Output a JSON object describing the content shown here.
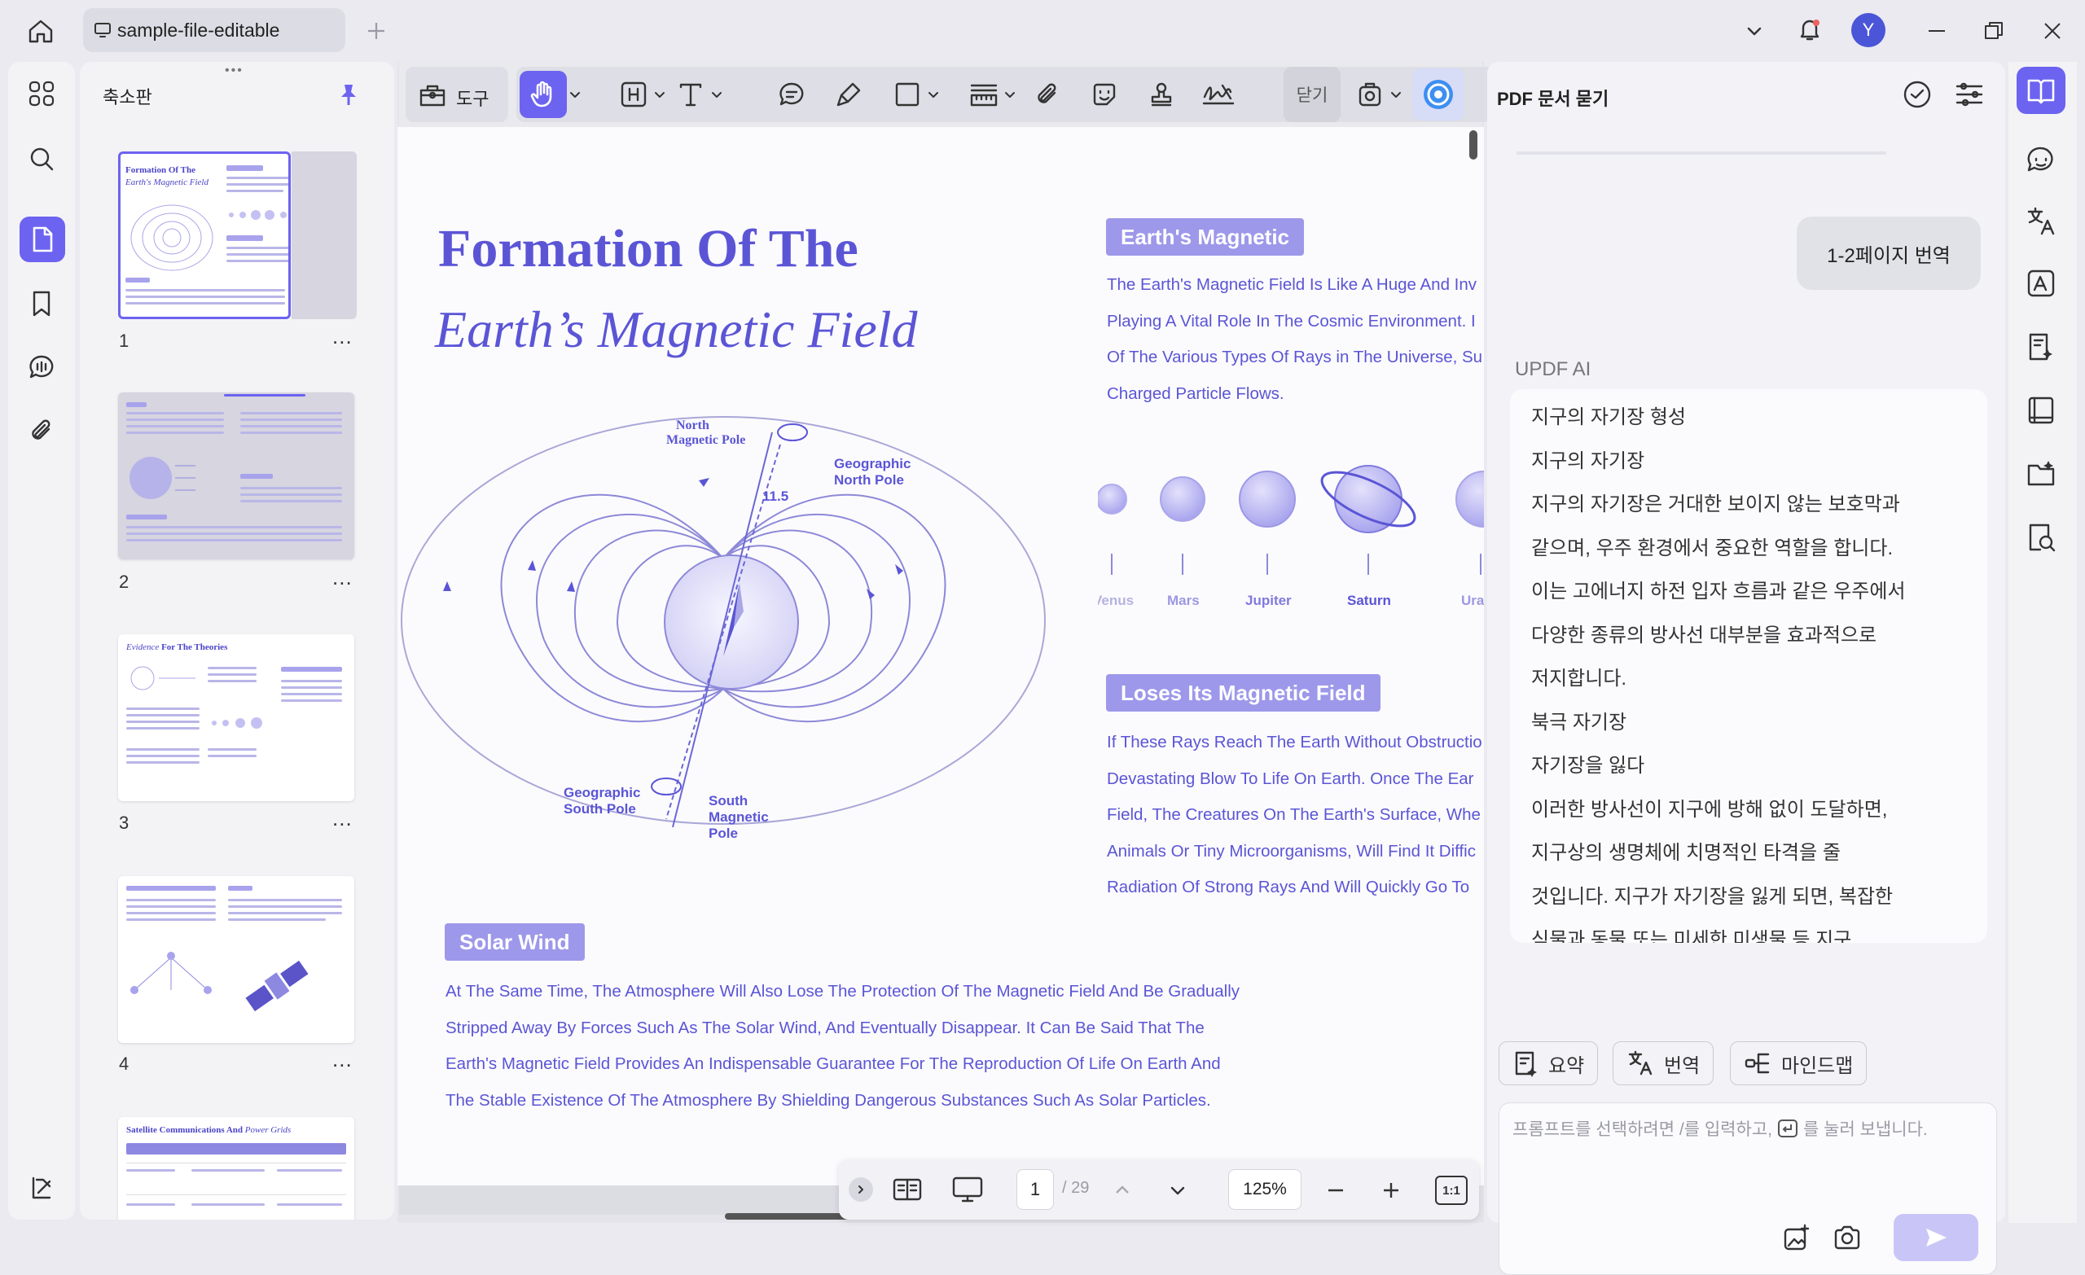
{
  "titlebar": {
    "tab_title": "sample-file-editable",
    "avatar_letter": "Y"
  },
  "thumbnails": {
    "title": "축소판",
    "pages": [
      {
        "number": "1",
        "menu": "..."
      },
      {
        "number": "2",
        "menu": "..."
      },
      {
        "number": "3",
        "menu": "..."
      },
      {
        "number": "4",
        "menu": "..."
      }
    ],
    "thumb1_title_a": "Formation Of The",
    "thumb1_title_b": "Earth's Magnetic Field",
    "thumb3_title_a": "Evidence",
    "thumb3_title_b": "For The Theories",
    "thumb5_title_a": "Satellite Communications And",
    "thumb5_title_b": "Power Grids"
  },
  "toolbar": {
    "tools_label": "도구",
    "close_label": "닫기"
  },
  "document": {
    "title_line1": "Formation Of The",
    "title_line2": "Earth’s Magnetic Field",
    "diagram": {
      "north_magnetic_pole_1": "North",
      "north_magnetic_pole_2": "Magnetic Pole",
      "geographic_north_1": "Geographic",
      "geographic_north_2": "North Pole",
      "angle": "11.5",
      "geographic_south_1": "Geographic",
      "geographic_south_2": "South Pole",
      "south_magnetic_1": "South",
      "south_magnetic_2": "Magnetic",
      "south_magnetic_3": "Pole"
    },
    "section1_heading": "Earth's Magnetic",
    "section1_lines": [
      "The Earth's Magnetic Field Is Like A Huge And Inv",
      "Playing A Vital Role In The Cosmic Environment. I",
      "Of The Various Types Of Rays in The Universe, Su",
      "Charged Particle Flows."
    ],
    "planets": [
      "Venus",
      "Mars",
      "Jupiter",
      "Saturn",
      "Ura"
    ],
    "section2_heading": "Loses Its Magnetic Field",
    "section2_lines": [
      "If These Rays Reach The Earth Without Obstructio",
      "Devastating Blow To Life On Earth. Once The Ear",
      "Field, The Creatures On The Earth's Surface, Whe",
      "Animals Or Tiny Microorganisms, Will Find It Diffic",
      "Radiation Of Strong Rays And Will Quickly Go To"
    ],
    "section3_heading": "Solar Wind",
    "section3_lines": [
      "At The Same Time, The Atmosphere Will Also Lose The Protection Of The Magnetic Field And Be Gradually",
      "Stripped Away By Forces Such As The Solar Wind, And Eventually Disappear. It Can Be Said That The",
      "Earth's Magnetic Field Provides An Indispensable Guarantee For The Reproduction Of Life On Earth And",
      "The Stable Existence Of The Atmosphere By Shielding Dangerous Substances Such As Solar Particles."
    ]
  },
  "pager": {
    "current_page": "1",
    "total_pages": "/ 29",
    "zoom": "125%",
    "fit_label": "1:1"
  },
  "ai_panel": {
    "title": "PDF 문서 묻기",
    "user_message": "1-2페이지 번역",
    "assistant_name": "UPDF AI",
    "response_lines": [
      "지구의 자기장 형성",
      "지구의 자기장",
      "지구의 자기장은 거대한 보이지 않는 보호막과",
      "같으며, 우주 환경에서 중요한 역할을 합니다.",
      "이는 고에너지 하전 입자 흐름과 같은 우주에서",
      "다양한 종류의 방사선 대부분을 효과적으로",
      "저지합니다.",
      "북극 자기장",
      "자기장을 잃다",
      "이러한 방사선이 지구에 방해 없이 도달하면,",
      "지구상의 생명체에 치명적인 타격을 줄",
      "것입니다. 지구가 자기장을 잃게 되면, 복잡한",
      "식물과 동물 또는 미세한 미생물 등 지구"
    ],
    "chip_summary": "요약",
    "chip_translate": "번역",
    "chip_mindmap": "마인드맵",
    "prompt_placeholder_a": "프롬프트를 선택하려면 /를 입력하고,",
    "prompt_placeholder_b": "를 눌러 보냅니다."
  },
  "colors": {
    "accent": "#6c63f0",
    "doc_text": "#5b55d6",
    "heading_bg": "#9d98ea"
  }
}
